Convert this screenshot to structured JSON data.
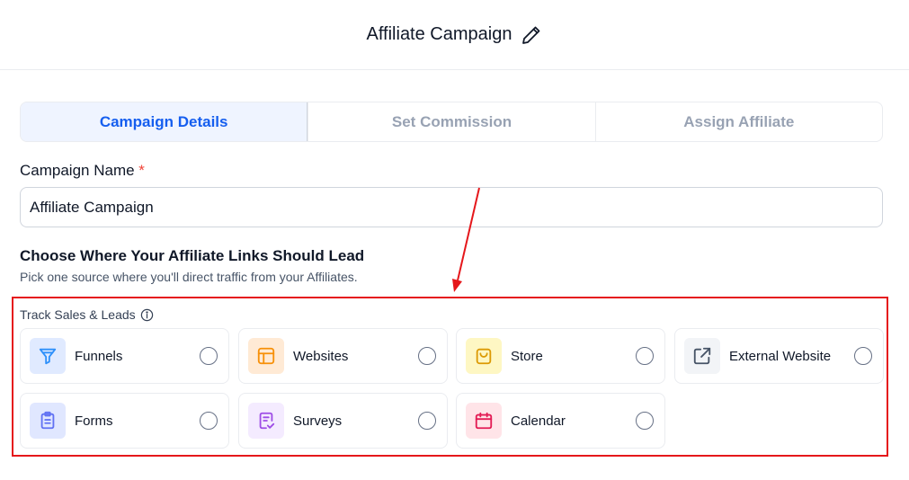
{
  "header": {
    "title": "Affiliate Campaign",
    "edit_icon": "pencil-icon"
  },
  "steps": [
    {
      "label": "Campaign Details",
      "active": true
    },
    {
      "label": "Set Commission",
      "active": false
    },
    {
      "label": "Assign Affiliate",
      "active": false
    }
  ],
  "campaign_name": {
    "label": "Campaign Name",
    "required_mark": "*",
    "value": "Affiliate Campaign"
  },
  "section": {
    "title": "Choose Where Your Affiliate Links Should Lead",
    "subtitle": "Pick one source where you'll direct traffic from your Affiliates."
  },
  "track": {
    "label": "Track Sales & Leads",
    "info_icon": "info-icon",
    "options": [
      {
        "label": "Funnels",
        "icon": "funnel-icon",
        "color": "#2e90fa",
        "bg": "#e0eaff"
      },
      {
        "label": "Websites",
        "icon": "website-icon",
        "color": "#f79009",
        "bg": "#ffead5"
      },
      {
        "label": "Store",
        "icon": "store-bag-icon",
        "color": "#dc9a04",
        "bg": "#fef7c3"
      },
      {
        "label": "External Website",
        "icon": "external-link-icon",
        "color": "#475467",
        "bg": "#f2f4f7"
      },
      {
        "label": "Forms",
        "icon": "clipboard-icon",
        "color": "#6172f3",
        "bg": "#e0e7ff"
      },
      {
        "label": "Surveys",
        "icon": "survey-icon",
        "color": "#9e4de6",
        "bg": "#f4ebff"
      },
      {
        "label": "Calendar",
        "icon": "calendar-icon",
        "color": "#e31b54",
        "bg": "#ffe4e8"
      }
    ]
  },
  "colors": {
    "accent": "#155eef",
    "annotation_red": "#e5171b"
  }
}
